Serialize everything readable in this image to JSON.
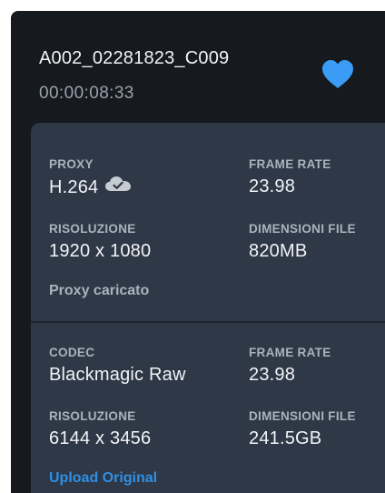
{
  "clip": {
    "name": "A002_02281823_C009",
    "timecode": "00:00:08:33",
    "favorite_icon": "heart-icon",
    "favorite_color": "#3a9cf5"
  },
  "proxy": {
    "codec_label": "PROXY",
    "codec_value": "H.264",
    "cloud_icon": "cloud-check-icon",
    "frame_rate_label": "FRAME RATE",
    "frame_rate_value": "23.98",
    "resolution_label": "RISOLUZIONE",
    "resolution_value": "1920 x 1080",
    "file_size_label": "DIMENSIONI FILE",
    "file_size_value": "820MB",
    "status": "Proxy caricato"
  },
  "original": {
    "codec_label": "CODEC",
    "codec_value": "Blackmagic Raw",
    "frame_rate_label": "FRAME RATE",
    "frame_rate_value": "23.98",
    "resolution_label": "RISOLUZIONE",
    "resolution_value": "6144 x 3456",
    "file_size_label": "DIMENSIONI FILE",
    "file_size_value": "241.5GB",
    "upload_label": "Upload Original",
    "link_color": "#2f8fe6"
  }
}
